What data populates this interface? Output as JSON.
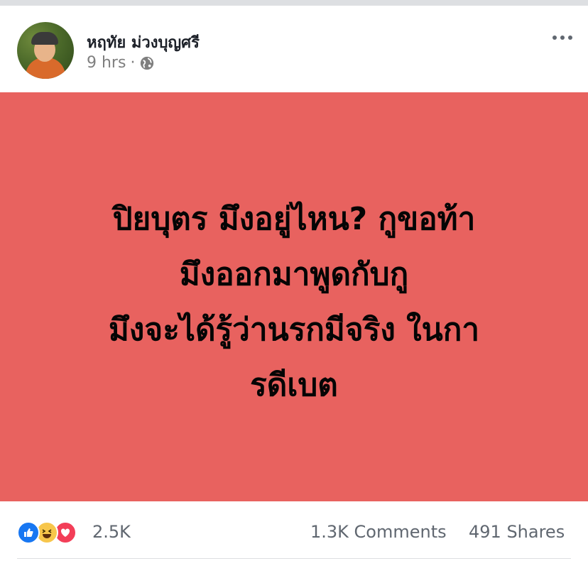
{
  "post": {
    "author": "หฤทัย ม่วงบุญศรี",
    "time": "9 hrs",
    "separator": "·",
    "privacy_icon": "globe-icon",
    "more_icon": "more-options-icon",
    "text": "ปิยบุตร มึงอยู่ไหน? กูขอท้า\nมึงออกมาพูดกับกู\nมึงจะได้รู้ว่านรกมีจริง ในกา\nรดีเบต",
    "background_color": "#e8625f"
  },
  "reactions": {
    "icons": [
      "like-icon",
      "haha-icon",
      "love-icon"
    ],
    "count": "2.5K",
    "comments": "1.3K Comments",
    "shares": "491 Shares"
  }
}
